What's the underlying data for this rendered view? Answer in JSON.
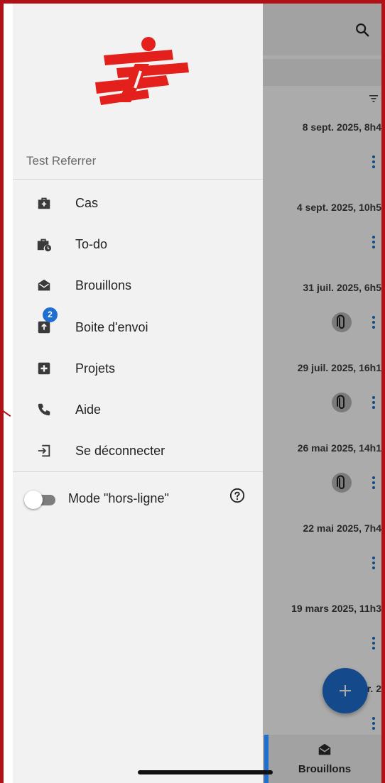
{
  "drawer": {
    "user_name": "Test Referrer",
    "menu": [
      {
        "label": "Cas",
        "icon": "briefcase-plus-icon"
      },
      {
        "label": "To-do",
        "icon": "briefcase-clock-icon"
      },
      {
        "label": "Brouillons",
        "icon": "envelope-open-icon"
      },
      {
        "label": "Boite d'envoi",
        "icon": "outbox-icon",
        "badge": "2"
      },
      {
        "label": "Projets",
        "icon": "plus-square-icon"
      },
      {
        "label": "Aide",
        "icon": "phone-icon"
      },
      {
        "label": "Se déconnecter",
        "icon": "logout-icon"
      }
    ],
    "offline_mode_label": "Mode \"hors-ligne\"",
    "offline_mode_on": false
  },
  "list": {
    "rows": [
      {
        "date": "8 sept. 2025, 8h4",
        "attachment": false
      },
      {
        "date": "4 sept. 2025, 10h5",
        "attachment": false
      },
      {
        "date": "31 juil. 2025, 6h5",
        "attachment": true
      },
      {
        "date": "29 juil. 2025, 16h1",
        "attachment": true
      },
      {
        "date": "26 mai 2025, 14h1",
        "attachment": true
      },
      {
        "date": "22 mai 2025, 7h4",
        "attachment": false
      },
      {
        "date": "19 mars 2025, 11h3",
        "attachment": false
      },
      {
        "date": "19 févr. 2",
        "attachment": false
      }
    ]
  },
  "bottom_nav": {
    "active_label": "Brouillons"
  },
  "colors": {
    "accent": "#1e6fd0",
    "brand_red": "#e3201b",
    "frame_red": "#b01217"
  }
}
